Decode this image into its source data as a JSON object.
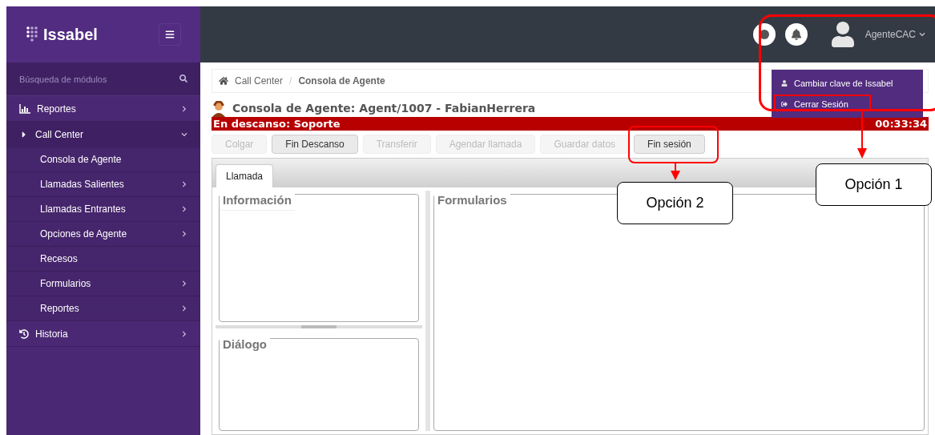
{
  "sidebar": {
    "logo": "Issabel",
    "search": {
      "placeholder": "Búsqueda de módulos"
    },
    "items": [
      {
        "label": "Reportes",
        "submenu": true,
        "expanded": false
      },
      {
        "label": "Call Center",
        "submenu": true,
        "expanded": true,
        "children": [
          {
            "label": "Consola de Agente",
            "submenu": false
          },
          {
            "label": "Llamadas Salientes",
            "submenu": true
          },
          {
            "label": "Llamadas Entrantes",
            "submenu": true
          },
          {
            "label": "Opciones de Agente",
            "submenu": true
          },
          {
            "label": "Recesos",
            "submenu": false
          },
          {
            "label": "Formularios",
            "submenu": true
          },
          {
            "label": "Reportes",
            "submenu": true
          }
        ]
      },
      {
        "label": "Historia",
        "submenu": true,
        "expanded": false
      }
    ]
  },
  "header": {
    "user": "AgenteCAC",
    "menu": [
      "Cambiar clave de Issabel",
      "Cerrar Sesión"
    ]
  },
  "breadcrumb": [
    "Call Center",
    "/",
    "Consola de Agente"
  ],
  "title": "Consola de Agente: Agent/1007 - FabianHerrera",
  "status": {
    "text": "En descanso: Soporte",
    "timer": "00:33:34"
  },
  "buttons": [
    {
      "label": "Colgar",
      "disabled": true
    },
    {
      "label": "Fin Descanso",
      "disabled": false
    },
    {
      "label": "Transferir",
      "disabled": true
    },
    {
      "label": "Agendar llamada",
      "disabled": true
    },
    {
      "label": "Guardar datos",
      "disabled": true
    },
    {
      "label": "Fin sesión",
      "disabled": false
    }
  ],
  "tabs": [
    {
      "label": "Llamada",
      "selected": true
    }
  ],
  "panels": {
    "info": "Información",
    "dialog": "Diálogo",
    "forms": "Formularios"
  },
  "callouts": [
    "Opción 1",
    "Opción 2"
  ]
}
